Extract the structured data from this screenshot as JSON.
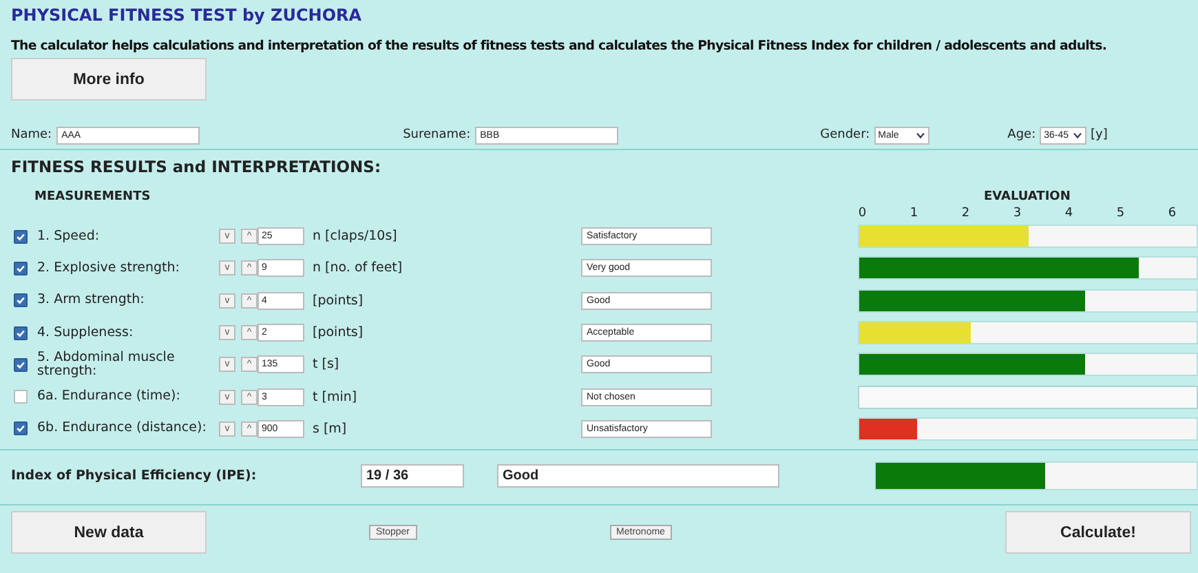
{
  "title": "PHYSICAL FITNESS TEST by ZUCHORA",
  "description": "The calculator helps calculations and interpretation of the results of fitness tests and calculates the Physical Fitness Index for children / adolescents and adults.",
  "more_info_button": "More info",
  "name": {
    "label": "Name:",
    "value": "AAA"
  },
  "surname": {
    "label": "Surename:",
    "value": "BBB"
  },
  "gender": {
    "label": "Gender:",
    "value": "Male"
  },
  "age": {
    "label": "Age:",
    "value": "36-45",
    "unit": "[y]"
  },
  "section_title": "FITNESS RESULTS and INTERPRETATIONS:",
  "measurements_header": "MEASUREMENTS",
  "evaluation_header": "EVALUATION",
  "scale": [
    "0",
    "1",
    "2",
    "3",
    "4",
    "5",
    "6"
  ],
  "rows": [
    {
      "checked": true,
      "label": "1. Speed:",
      "decrement": "v",
      "increment": "^",
      "value": "25",
      "unit": "n [claps/10s]",
      "evaluation": "Satisfactory",
      "level": 0.5,
      "color": "#e8e030"
    },
    {
      "checked": true,
      "label": "2. Explosive strength:",
      "decrement": "v",
      "increment": "^",
      "value": "9",
      "unit": "n [no. of feet]",
      "evaluation": "Very good",
      "level": 0.83,
      "color": "#0a7a0a"
    },
    {
      "checked": true,
      "label": "3. Arm strength:",
      "decrement": "v",
      "increment": "^",
      "value": "4",
      "unit": "[points]",
      "evaluation": "Good",
      "level": 0.67,
      "color": "#0a7a0a"
    },
    {
      "checked": true,
      "label": "4. Suppleness:",
      "decrement": "v",
      "increment": "^",
      "value": "2",
      "unit": "[points]",
      "evaluation": "Acceptable",
      "level": 0.33,
      "color": "#e8e030"
    },
    {
      "checked": true,
      "label": "5. Abdominal muscle strength:",
      "decrement": "v",
      "increment": "^",
      "value": "135",
      "unit": "t [s]",
      "evaluation": "Good",
      "level": 0.67,
      "color": "#0a7a0a"
    },
    {
      "checked": false,
      "label": "6a. Endurance (time):",
      "decrement": "v",
      "increment": "^",
      "value": "3",
      "unit": "t [min]",
      "evaluation": "Not chosen",
      "evaluation_shown": false
    },
    {
      "checked": true,
      "label": "6b. Endurance (distance):",
      "decrement": "v",
      "increment": "^",
      "value": "900",
      "unit": "s [m]",
      "evaluation": "Unsatisfactory",
      "level": 0.17,
      "color": "#e03020"
    }
  ],
  "ipe": {
    "label": "Index of Physical Efficiency (IPE):",
    "score": "19 / 36",
    "evaluation": "Good",
    "level": 0.53,
    "color": "#0a7a0a"
  },
  "buttons": {
    "new_data": "New data",
    "stopper": "Stopper",
    "metronome": "Metronome",
    "calculate": "Calculate!"
  }
}
